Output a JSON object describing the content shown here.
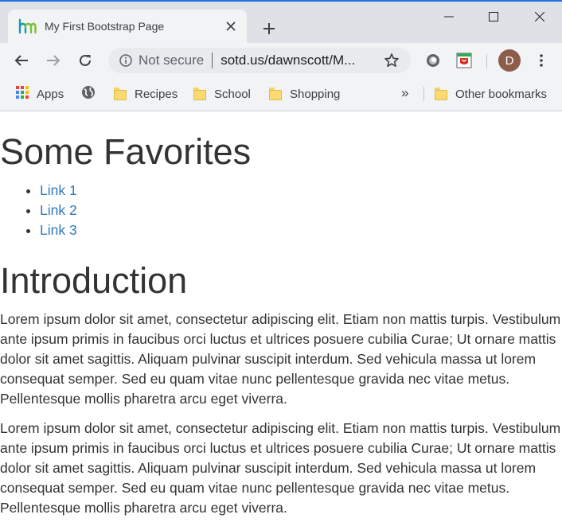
{
  "browser": {
    "tab": {
      "title": "My First Bootstrap Page"
    },
    "omnibox": {
      "security": "Not secure",
      "url": "sotd.us/dawnscott/M..."
    },
    "profile_initial": "D",
    "bookmarks": [
      {
        "label": "Apps",
        "icon": "apps-grid-icon"
      },
      {
        "label": "",
        "icon": "globe-icon"
      },
      {
        "label": "Recipes",
        "icon": "folder-icon"
      },
      {
        "label": "School",
        "icon": "folder-icon"
      },
      {
        "label": "Shopping",
        "icon": "folder-icon"
      }
    ],
    "overflow_label": "»",
    "other_bookmarks": "Other bookmarks",
    "accent": "#1a73e8"
  },
  "page": {
    "heading1": "Some Favorites",
    "links": [
      "Link 1",
      "Link 2",
      "Link 3"
    ],
    "heading2": "Introduction",
    "paragraphs": [
      "Lorem ipsum dolor sit amet, consectetur adipiscing elit. Etiam non mattis turpis. Vestibulum ante ipsum primis in faucibus orci luctus et ultrices posuere cubilia Curae; Ut ornare mattis dolor sit amet sagittis. Aliquam pulvinar suscipit interdum. Sed vehicula massa ut lorem consequat semper. Sed eu quam vitae nunc pellentesque gravida nec vitae metus. Pellentesque mollis pharetra arcu eget viverra.",
      "Lorem ipsum dolor sit amet, consectetur adipiscing elit. Etiam non mattis turpis. Vestibulum ante ipsum primis in faucibus orci luctus et ultrices posuere cubilia Curae; Ut ornare mattis dolor sit amet sagittis. Aliquam pulvinar suscipit interdum. Sed vehicula massa ut lorem consequat semper. Sed eu quam vitae nunc pellentesque gravida nec vitae metus. Pellentesque mollis pharetra arcu eget viverra."
    ],
    "link_color": "#337ab7",
    "text_color": "#333333"
  }
}
